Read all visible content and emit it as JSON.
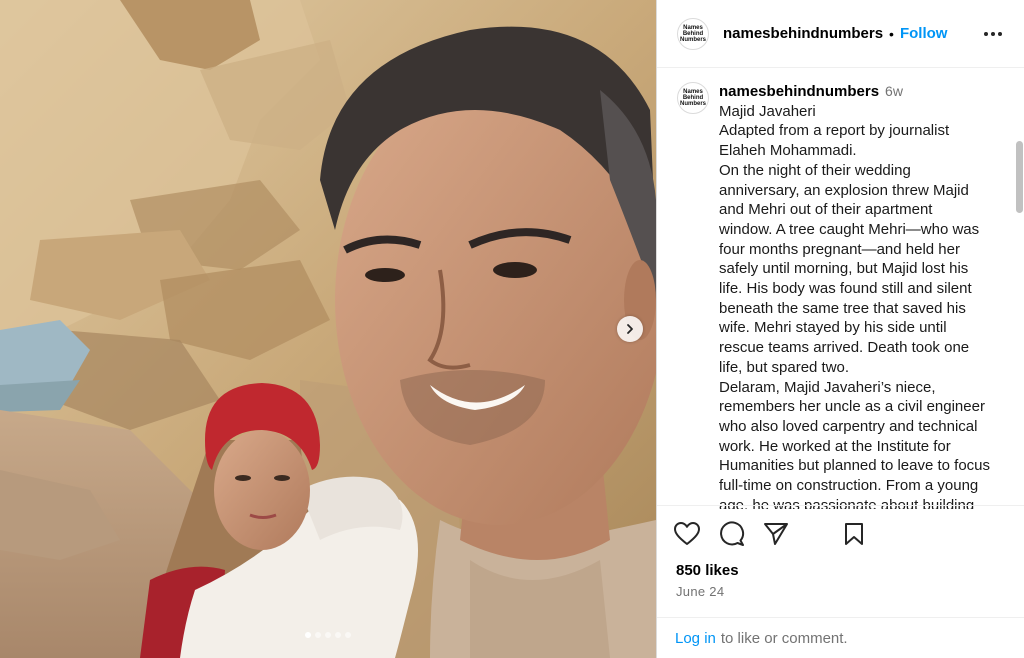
{
  "account": {
    "username": "namesbehindnumbers",
    "avatar_text": [
      "Names",
      "Behind",
      "Numbers"
    ],
    "follow_label": "Follow",
    "separator": "•"
  },
  "caption": {
    "username": "namesbehindnumbers",
    "time": "6w",
    "lines": [
      "Majid Javaheri",
      "Adapted from a report by journalist",
      "Elaheh Mohammadi.",
      "On the night of their wedding",
      "anniversary, an explosion threw Majid",
      "and Mehri out of their apartment",
      "window. A tree caught Mehri—who was",
      "four months pregnant—and held her",
      "safely until morning, but Majid lost his",
      "life. His body was found still and silent",
      "beneath the same tree that saved his",
      "wife. Mehri stayed by his side until",
      "rescue teams arrived. Death took one",
      "life, but spared two.",
      "Delaram, Majid Javaheri’s niece,",
      "remembers her uncle as a civil engineer",
      "who also loved carpentry and technical",
      "work. He worked at the Institute for",
      "Humanities but planned to leave to focus",
      "full-time on construction. From a young",
      "age, he was passionate about building"
    ]
  },
  "engagement": {
    "likes": "850 likes",
    "date": "June 24"
  },
  "login": {
    "link": "Log in",
    "rest": "to like or comment."
  },
  "carousel": {
    "slide_count": 5,
    "active_index": 0
  },
  "icons": {
    "more": "more-options-icon",
    "like": "heart-icon",
    "comment": "comment-icon",
    "share": "share-icon",
    "save": "bookmark-icon",
    "next": "chevron-right-icon"
  }
}
